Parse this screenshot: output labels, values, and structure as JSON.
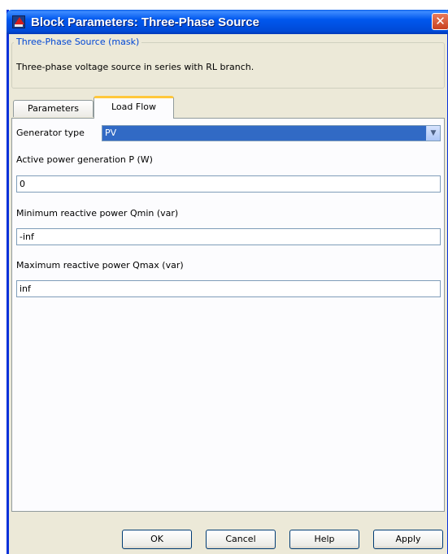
{
  "window": {
    "title": "Block Parameters: Three-Phase Source",
    "close_glyph": "✕",
    "app_icon": "simulink-block-icon",
    "colors": {
      "titlebar": "#0054e3",
      "frame": "#ece9d8",
      "group_title": "#0046d5",
      "selection": "#316ac5",
      "tab_highlight": "#ffc83c"
    }
  },
  "mask": {
    "title": "Three-Phase Source (mask)",
    "description": "Three-phase voltage source in series with RL branch."
  },
  "tabs": [
    {
      "label": "Parameters",
      "active": false
    },
    {
      "label": "Load Flow",
      "active": true
    }
  ],
  "load_flow": {
    "generator_type_label": "Generator type",
    "generator_type_value": "PV",
    "active_power_label": "Active power generation P (W)",
    "active_power_value": "0",
    "qmin_label": "Minimum reactive power Qmin (var)",
    "qmin_value": "-inf",
    "qmax_label": "Maximum reactive power Qmax (var)",
    "qmax_value": "inf"
  },
  "buttons": {
    "ok": "OK",
    "cancel": "Cancel",
    "help": "Help",
    "apply": "Apply"
  }
}
